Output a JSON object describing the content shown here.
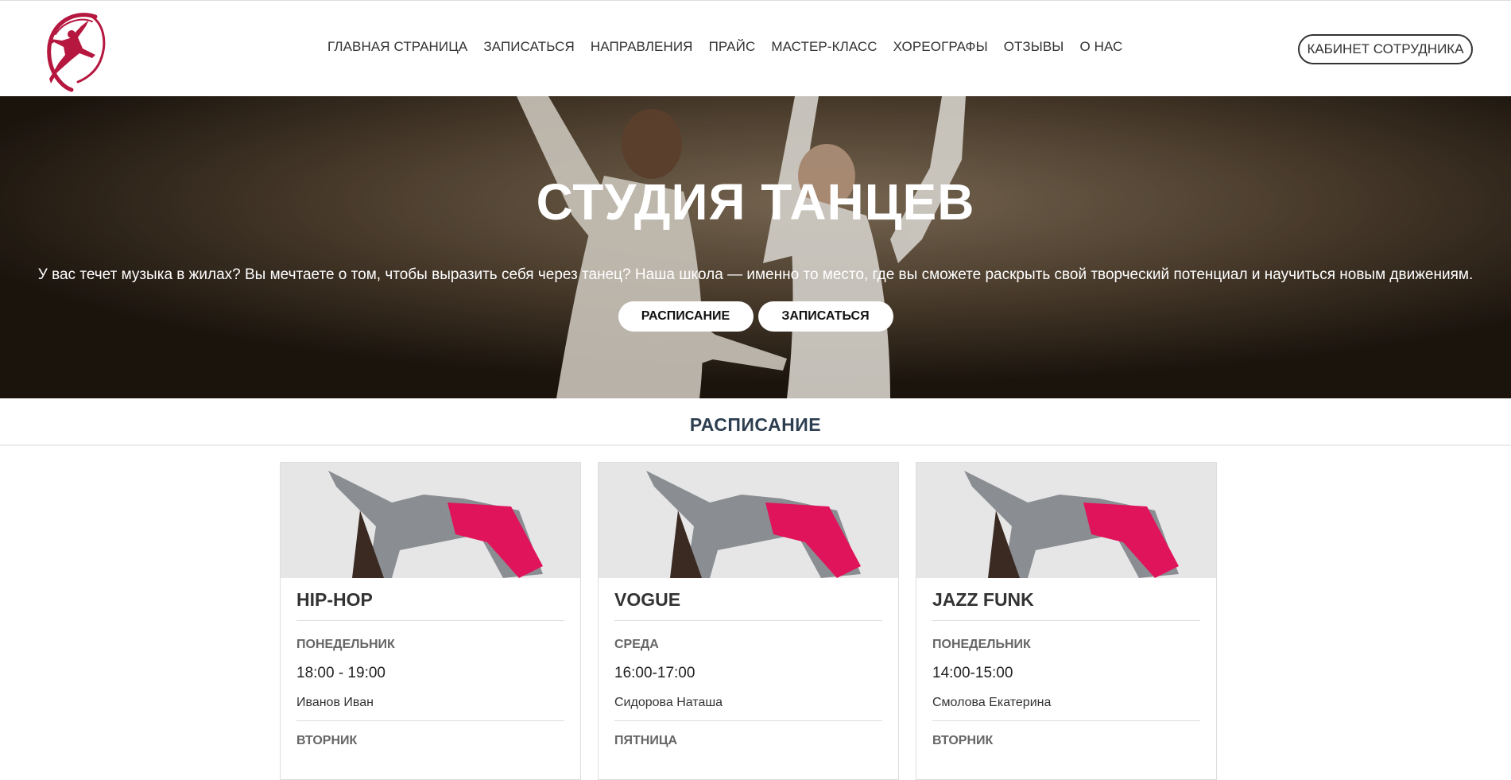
{
  "header": {
    "nav": [
      "ГЛАВНАЯ СТРАНИЦА",
      "ЗАПИСАТЬСЯ",
      "НАПРАВЛЕНИЯ",
      "ПРАЙС",
      "МАСТЕР-КЛАСС",
      "ХОРЕОГРАФЫ",
      "ОТЗЫВЫ",
      "О НАС"
    ],
    "staff_button": "КАБИНЕТ СОТРУДНИКА"
  },
  "hero": {
    "title": "СТУДИЯ ТАНЦЕВ",
    "text": "У вас течет музыка в жилах? Вы мечтаете о том, чтобы выразить себя через танец? Наша школа — именно то место, где вы сможете раскрыть свой творческий потенциал и научиться новым движениям.",
    "buttons": [
      "РАСПИСАНИЕ",
      "ЗАПИСАТЬСЯ"
    ]
  },
  "schedule": {
    "title": "РАСПИСАНИЕ",
    "cards": [
      {
        "title": "HIP-HOP",
        "day": "ПОНЕДЕЛЬНИК",
        "time": "18:00 - 19:00",
        "teacher": "Иванов Иван",
        "next_day": "ВТОРНИК"
      },
      {
        "title": "VOGUE",
        "day": "СРЕДА",
        "time": "16:00-17:00",
        "teacher": "Сидорова Наташа",
        "next_day": "ПЯТНИЦА"
      },
      {
        "title": "JAZZ FUNK",
        "day": "ПОНЕДЕЛЬНИК",
        "time": "14:00-15:00",
        "teacher": "Смолова Екатерина",
        "next_day": "ВТОРНИК"
      }
    ]
  },
  "colors": {
    "logo": "#b5173f",
    "heading": "#2c3e50",
    "hero_bg": "#5d4c3a"
  }
}
